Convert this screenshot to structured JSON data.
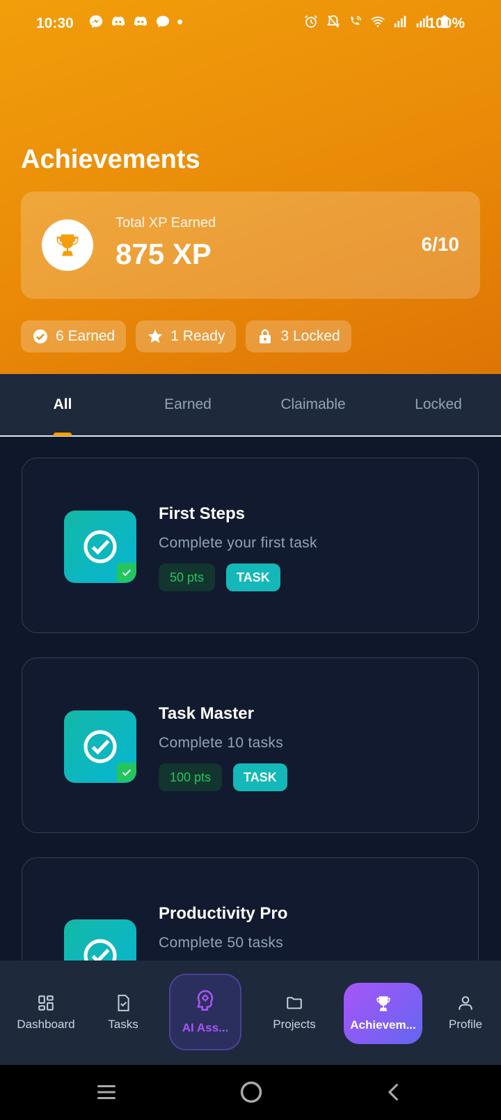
{
  "status_bar": {
    "time": "10:30",
    "battery": "100%"
  },
  "header": {
    "title": "Achievements",
    "xp_card": {
      "label": "Total XP Earned",
      "value": "875 XP",
      "progress": "6/10"
    },
    "stats": [
      {
        "icon": "check-circle-icon",
        "label": "6 Earned"
      },
      {
        "icon": "star-icon",
        "label": "1 Ready"
      },
      {
        "icon": "lock-icon",
        "label": "3 Locked"
      }
    ]
  },
  "tabs": [
    {
      "label": "All",
      "active": true
    },
    {
      "label": "Earned",
      "active": false
    },
    {
      "label": "Claimable",
      "active": false
    },
    {
      "label": "Locked",
      "active": false
    }
  ],
  "achievements": [
    {
      "title": "First Steps",
      "description": "Complete your first task",
      "points": "50 pts",
      "category": "TASK",
      "earned": true
    },
    {
      "title": "Task Master",
      "description": "Complete 10 tasks",
      "points": "100 pts",
      "category": "TASK",
      "earned": true
    },
    {
      "title": "Productivity Pro",
      "description": "Complete 50 tasks",
      "points": "",
      "category": "",
      "earned": true
    }
  ],
  "bottom_nav": [
    {
      "label": "Dashboard",
      "icon": "dashboard-icon"
    },
    {
      "label": "Tasks",
      "icon": "tasks-icon"
    },
    {
      "label": "AI Ass...",
      "icon": "ai-brain-icon"
    },
    {
      "label": "Projects",
      "icon": "folder-icon"
    },
    {
      "label": "Achievem...",
      "icon": "trophy-icon",
      "active": true
    },
    {
      "label": "Profile",
      "icon": "profile-icon"
    }
  ],
  "colors": {
    "header_orange": "#f29e0b",
    "accent_teal": "#14b8a6",
    "earned_green": "#22c55e",
    "active_purple": "#a855f7"
  }
}
